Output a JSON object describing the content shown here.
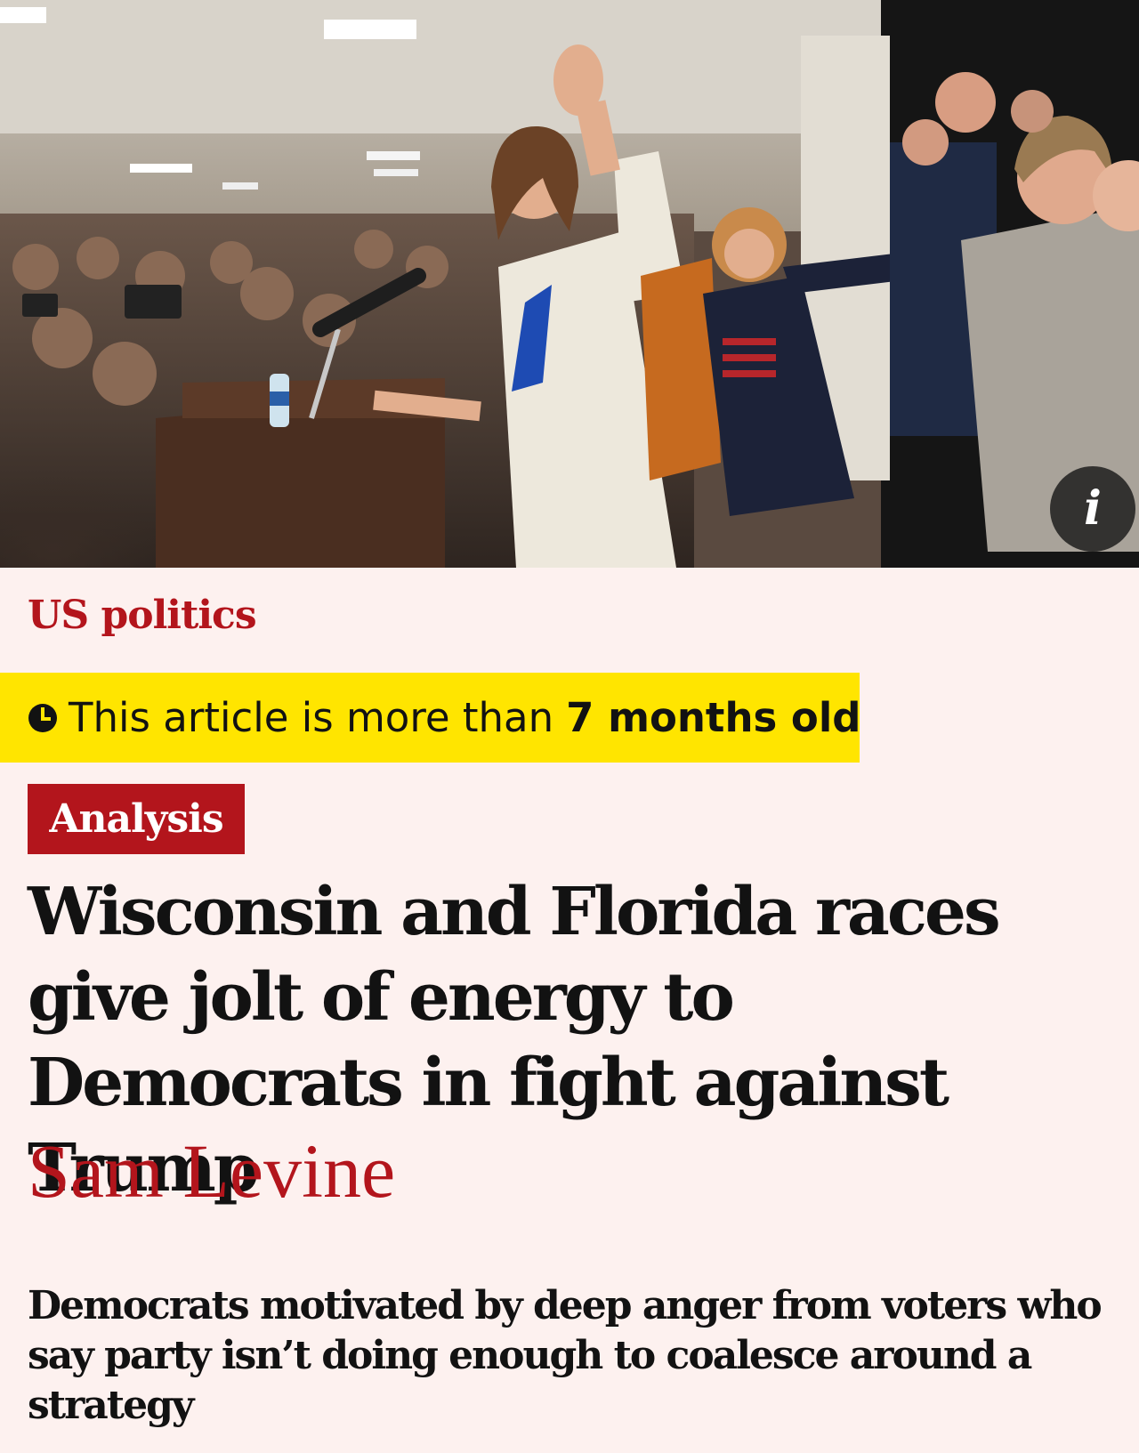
{
  "hero": {
    "image_icon": "photo-campaign-rally",
    "info_icon": "info-icon",
    "info_glyph": "i"
  },
  "article": {
    "section": "US politics",
    "age_warning": {
      "icon": "clock-icon",
      "prefix": "This article is more than",
      "age": "7 months old"
    },
    "tone_badge": "Analysis",
    "headline": "Wisconsin and Florida races give jolt of energy to Democrats in fight against Trump",
    "byline": "Sam Levine",
    "standfirst": "Democrats motivated by deep anger from voters who say party isn’t doing enough to coalesce around a strategy"
  },
  "colors": {
    "background": "#fdf1ef",
    "news_red": "#b3151c",
    "age_warning_yellow": "#ffe500",
    "text": "#121212"
  }
}
